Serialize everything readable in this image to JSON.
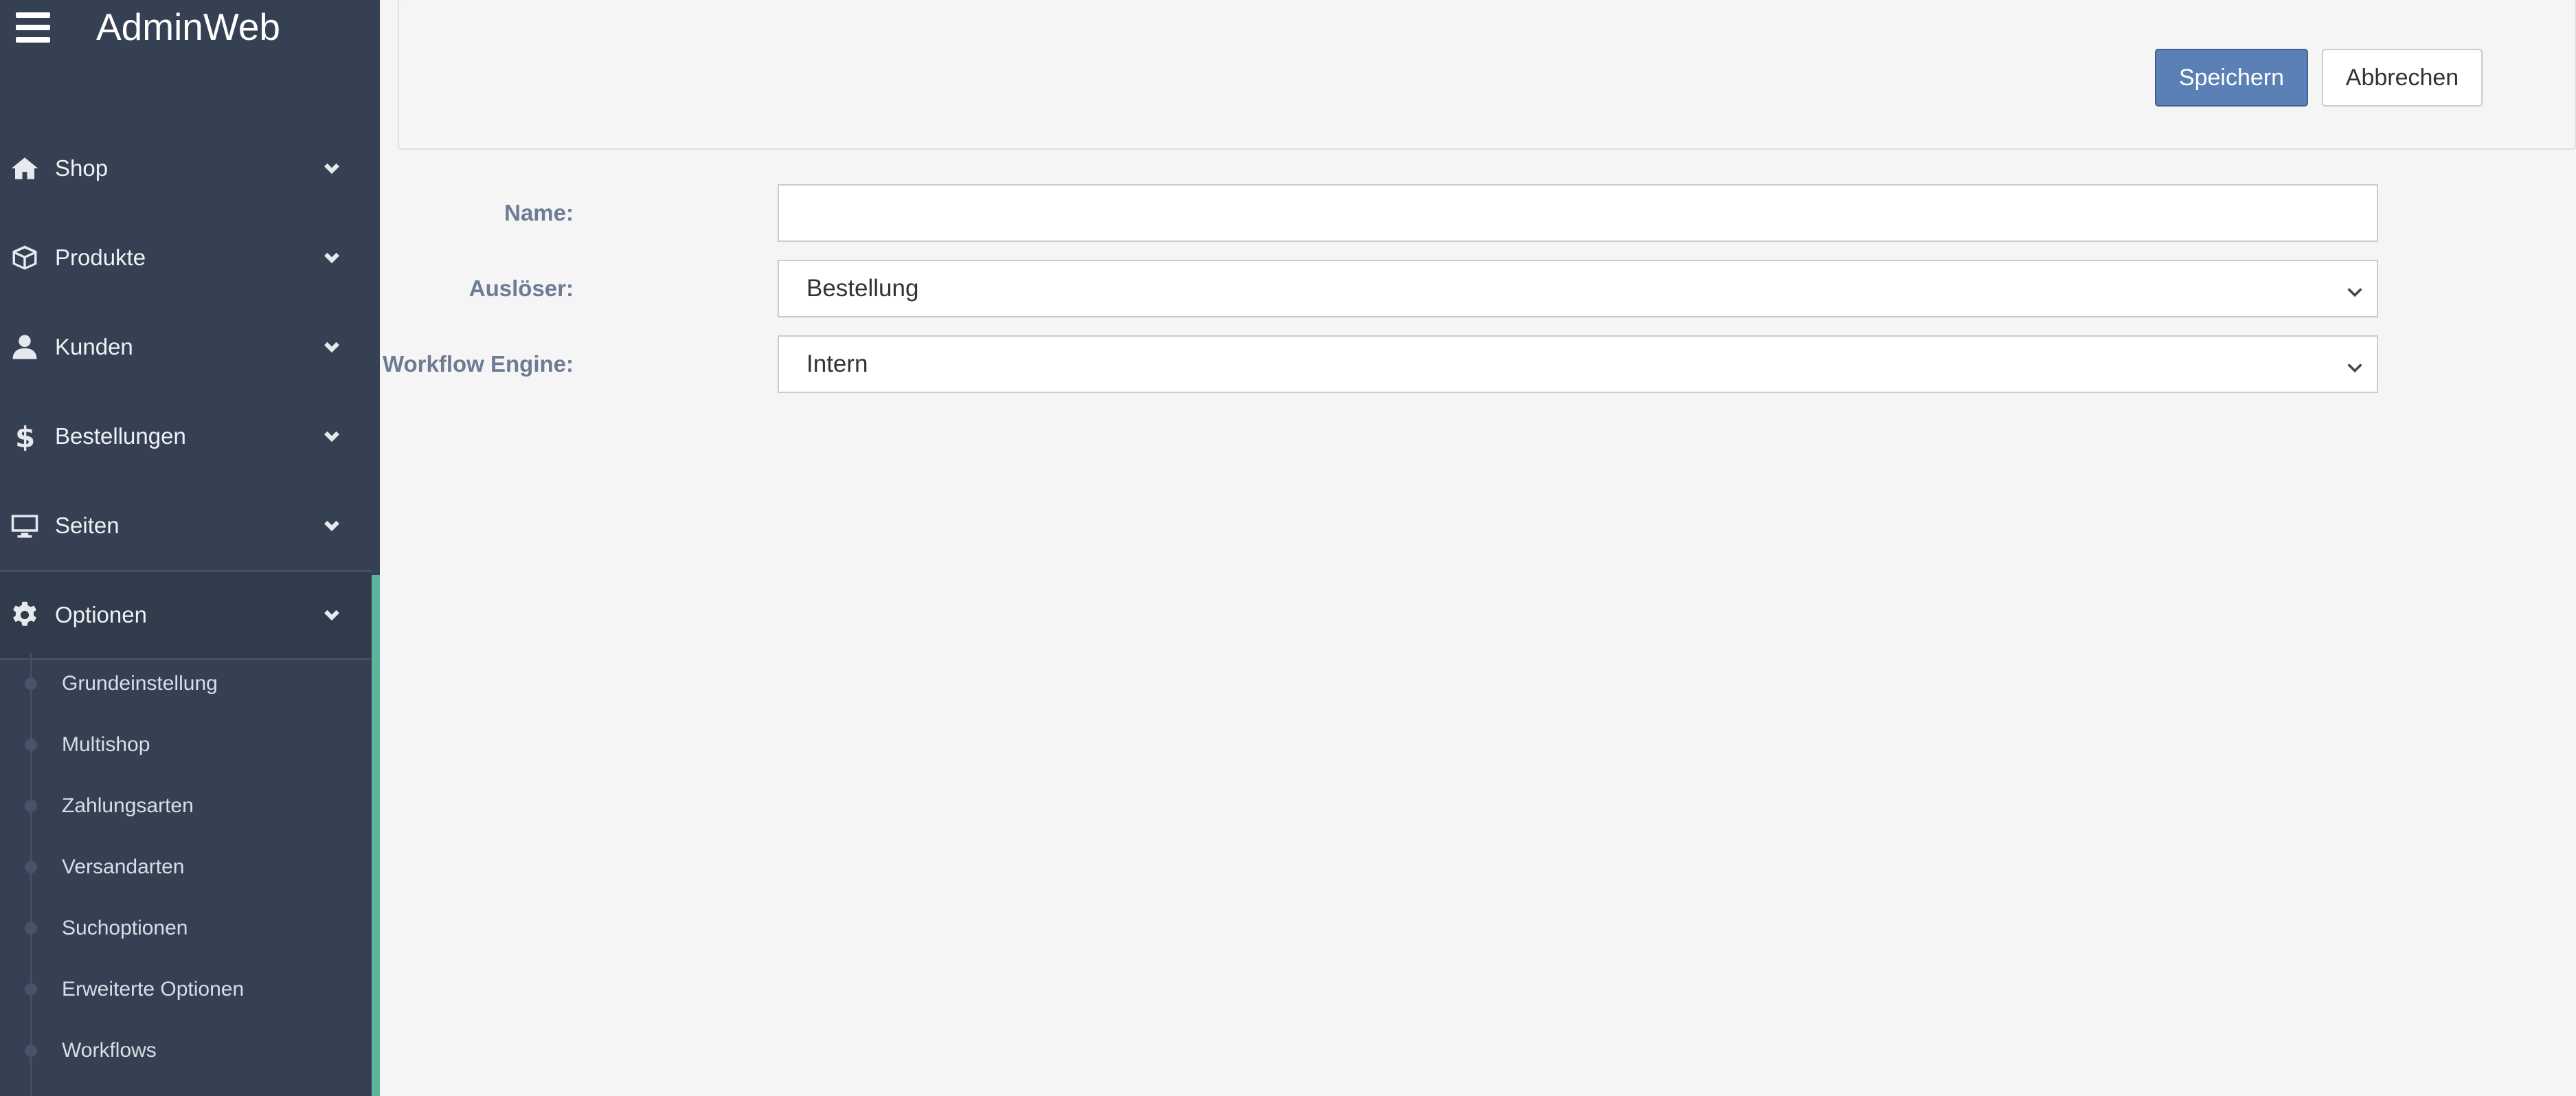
{
  "app": {
    "title": "AdminWeb"
  },
  "colors": {
    "accent": "#5fb49c",
    "sidebar_bg": "#354052",
    "primary_button": "#5b80b5"
  },
  "sidebar": {
    "items": [
      {
        "label": "Shop",
        "icon": "home-icon"
      },
      {
        "label": "Produkte",
        "icon": "box-icon"
      },
      {
        "label": "Kunden",
        "icon": "user-icon"
      },
      {
        "label": "Bestellungen",
        "icon": "dollar-icon"
      },
      {
        "label": "Seiten",
        "icon": "monitor-icon"
      },
      {
        "label": "Optionen",
        "icon": "gear-icon",
        "active": true
      }
    ],
    "submenu": [
      {
        "label": "Grundeinstellung"
      },
      {
        "label": "Multishop"
      },
      {
        "label": "Zahlungsarten"
      },
      {
        "label": "Versandarten"
      },
      {
        "label": "Suchoptionen"
      },
      {
        "label": "Erweiterte Optionen"
      },
      {
        "label": "Workflows"
      }
    ]
  },
  "toolbar": {
    "save_label": "Speichern",
    "cancel_label": "Abbrechen"
  },
  "form": {
    "name": {
      "label": "Name:",
      "value": "",
      "placeholder": ""
    },
    "trigger": {
      "label": "Auslöser:",
      "value": "Bestellung"
    },
    "engine": {
      "label": "Workflow Engine:",
      "value": "Intern"
    }
  }
}
